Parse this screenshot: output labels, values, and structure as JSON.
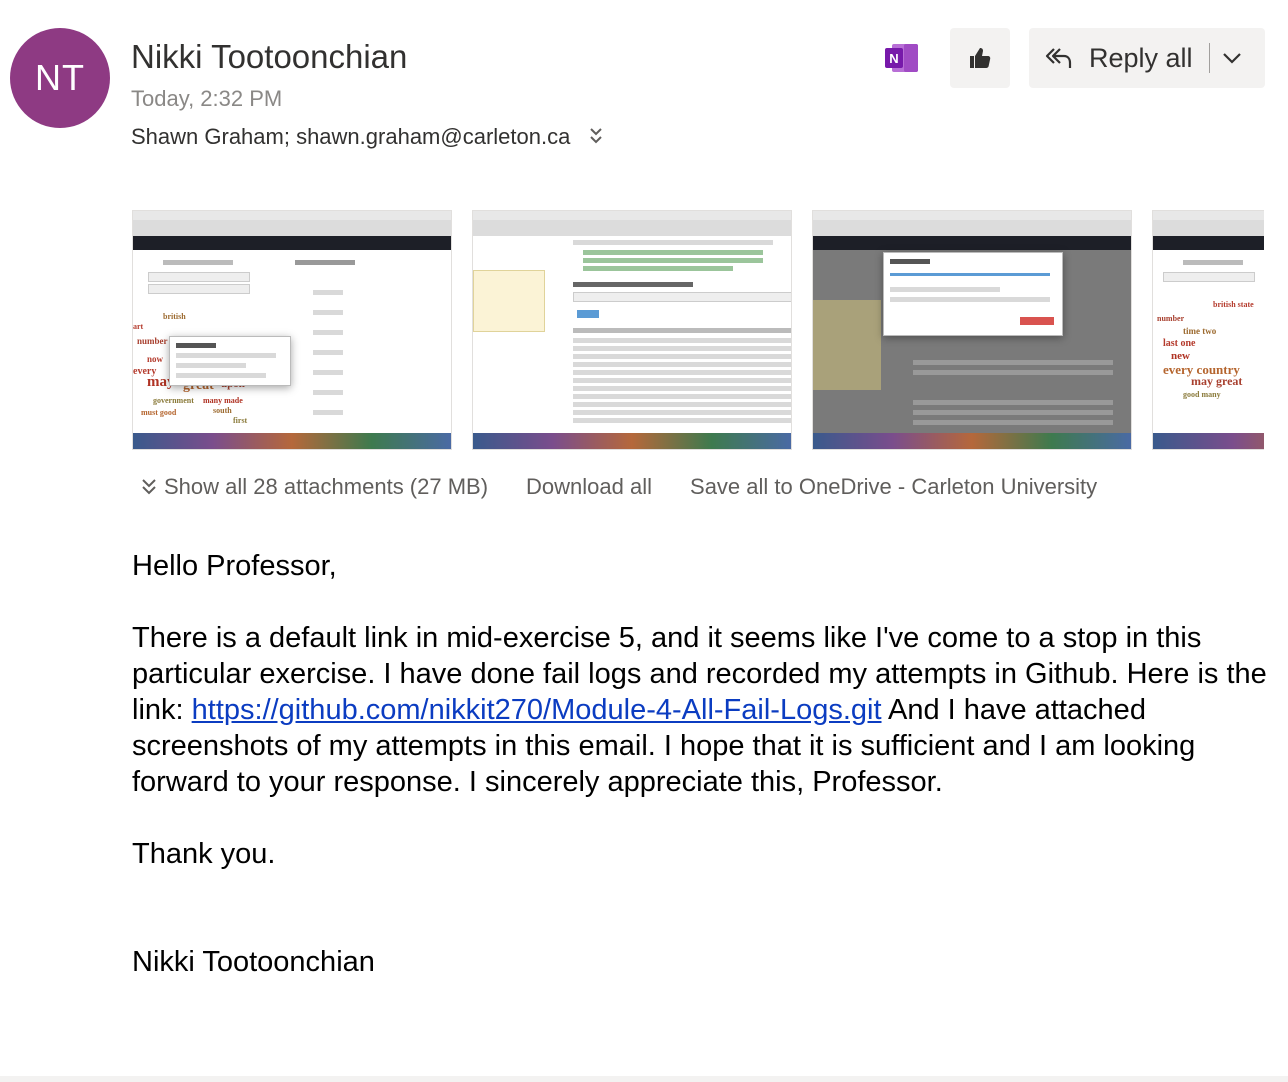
{
  "header": {
    "avatar_initials": "NT",
    "avatar_color": "#8e3a83",
    "sender_name": "Nikki Tootoonchian",
    "timestamp": "Today, 2:32 PM",
    "recipients": "Shawn Graham; shawn.graham@carleton.ca",
    "actions": {
      "onenote_icon": "onenote-icon",
      "like_icon": "thumbs-up-icon",
      "reply_all_label": "Reply all",
      "reply_icon": "reply-all-icon",
      "dropdown_icon": "chevron-down-icon"
    }
  },
  "attachments": {
    "show_all_label": "Show all 28 attachments (27 MB)",
    "download_all_label": "Download all",
    "save_onedrive_label": "Save all to OneDrive - Carleton University",
    "thumbnails": [
      {
        "kind": "word-cloud-search",
        "name": "attachment-thumbnail-1"
      },
      {
        "kind": "csv-preview-table",
        "name": "attachment-thumbnail-2"
      },
      {
        "kind": "uploading-dialog",
        "name": "attachment-thumbnail-3"
      },
      {
        "kind": "word-cloud",
        "name": "attachment-thumbnail-4"
      }
    ]
  },
  "message": {
    "greeting": "Hello Professor,",
    "para1_before_link": "There is a default link in mid-exercise 5, and it seems like I've come to a stop in this particular exercise. I have done fail logs and recorded my attempts in Github. Here is the link: ",
    "link_text": "https://github.com/nikkit270/Module-4-All-Fail-Logs.git",
    "para1_after_link": " And I have attached screenshots of my attempts in this email. I hope that it is sufficient and I am looking forward to your response. I sincerely appreciate this, Professor.",
    "closing": "Thank you.",
    "signature": "Nikki Tootoonchian"
  }
}
